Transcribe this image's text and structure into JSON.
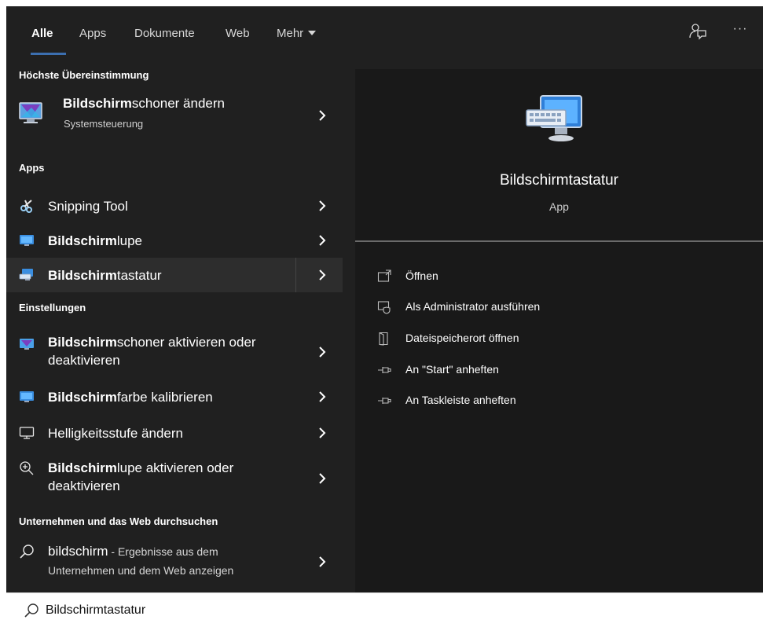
{
  "tabs": [
    {
      "label": "Alle"
    },
    {
      "label": "Apps"
    },
    {
      "label": "Dokumente"
    },
    {
      "label": "Web"
    },
    {
      "label": "Mehr"
    }
  ],
  "topbar": {
    "more_label": "···"
  },
  "sections": {
    "best_match": "Höchste Übereinstimmung",
    "apps": "Apps",
    "settings": "Einstellungen",
    "web": "Unternehmen und das Web durchsuchen"
  },
  "best_match": {
    "title_bold": "Bildschirm",
    "title_rest": "schoner ändern",
    "subtitle": "Systemsteuerung"
  },
  "apps": [
    {
      "bold": "",
      "rest": "Snipping Tool"
    },
    {
      "bold": "Bildschirm",
      "rest": "lupe"
    },
    {
      "bold": "Bildschirm",
      "rest": "tastatur"
    }
  ],
  "settings": [
    {
      "bold": "Bildschirm",
      "rest": "schoner aktivieren oder",
      "line2": "deaktivieren"
    },
    {
      "bold": "Bildschirm",
      "rest": "farbe kalibrieren",
      "line2": ""
    },
    {
      "bold": "",
      "rest": "Helligkeitsstufe ändern",
      "line2": ""
    },
    {
      "bold": "Bildschirm",
      "rest": "lupe aktivieren oder",
      "line2": "deaktivieren"
    }
  ],
  "web_result": {
    "query": "bildschirm",
    "suffix": " - Ergebnisse aus dem",
    "line2": "Unternehmen und dem Web anzeigen"
  },
  "detail": {
    "app_name": "Bildschirmtastatur",
    "app_type": "App",
    "actions": [
      {
        "label": "Öffnen",
        "icon": "open-icon"
      },
      {
        "label": "Als Administrator ausführen",
        "icon": "shield-icon"
      },
      {
        "label": "Dateispeicherort öffnen",
        "icon": "folder-icon"
      },
      {
        "label": "An \"Start\" anheften",
        "icon": "pin-icon"
      },
      {
        "label": "An Taskleiste anheften",
        "icon": "pin-icon"
      }
    ]
  },
  "search": {
    "value": "Bildschirmtastatur"
  },
  "colors": {
    "accent": "#3c6fb0",
    "panel_bg": "#202020",
    "detail_bg": "#191919",
    "selected_row": "#2d2d2d"
  }
}
